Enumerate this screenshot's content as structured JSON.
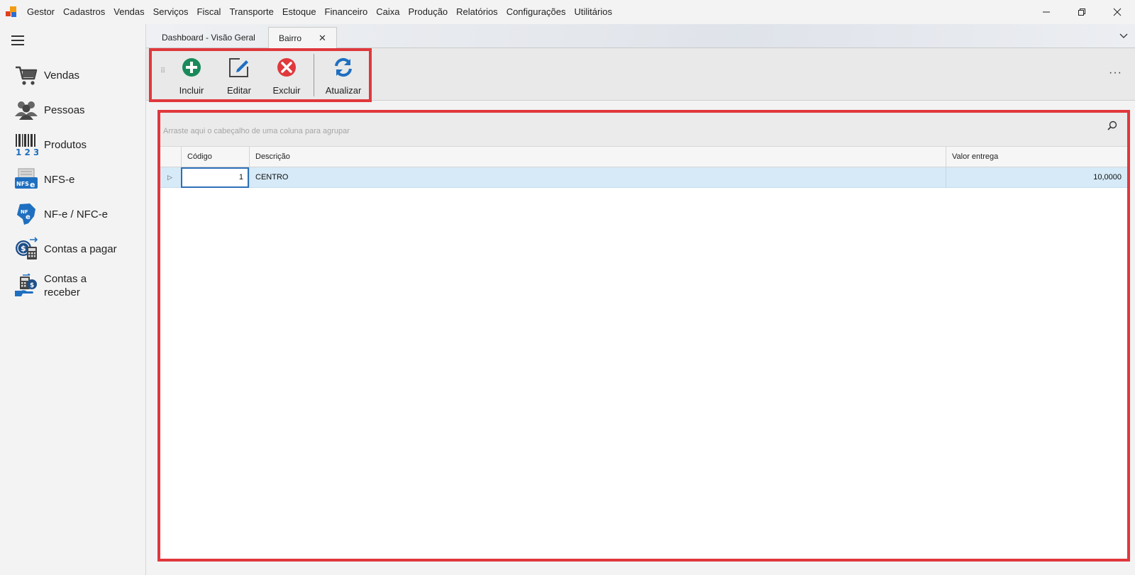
{
  "app": {
    "name": "Gestor",
    "brand_colors": [
      "#e04020",
      "#f39c12",
      "#2a6fd6"
    ]
  },
  "menu": [
    "Cadastros",
    "Vendas",
    "Serviços",
    "Fiscal",
    "Transporte",
    "Estoque",
    "Financeiro",
    "Caixa",
    "Produção",
    "Relatórios",
    "Configurações",
    "Utilitários"
  ],
  "window_controls": {
    "minimize_icon": "minimize-icon",
    "restore_icon": "restore-icon",
    "close_icon": "close-icon"
  },
  "sidebar": {
    "items": [
      {
        "label": "Vendas",
        "icon": "shopping-cart-icon"
      },
      {
        "label": "Pessoas",
        "icon": "people-icon"
      },
      {
        "label": "Produtos",
        "icon": "barcode-icon"
      },
      {
        "label": "NFS-e",
        "icon": "nfse-icon"
      },
      {
        "label": "NF-e / NFC-e",
        "icon": "nfe-icon"
      },
      {
        "label": "Contas a pagar",
        "icon": "bills-pay-icon"
      },
      {
        "label": "Contas a receber",
        "icon": "bills-receive-icon"
      }
    ]
  },
  "tabs": [
    {
      "label": "Dashboard - Visão Geral",
      "active": false
    },
    {
      "label": "Bairro",
      "active": true
    }
  ],
  "toolbar": {
    "incluir": "Incluir",
    "editar": "Editar",
    "excluir": "Excluir",
    "atualizar": "Atualizar",
    "more": "···"
  },
  "grid": {
    "group_placeholder": "Arraste aqui o cabeçalho de uma coluna para agrupar",
    "columns": [
      "Código",
      "Descrição",
      "Valor entrega"
    ],
    "rows": [
      {
        "codigo": "1",
        "descricao": "CENTRO",
        "valor_entrega": "10,0000"
      }
    ]
  },
  "colors": {
    "highlight_border": "#e0383c",
    "selected_row": "#d6eaf8",
    "focus_border": "#2d6fb8"
  }
}
